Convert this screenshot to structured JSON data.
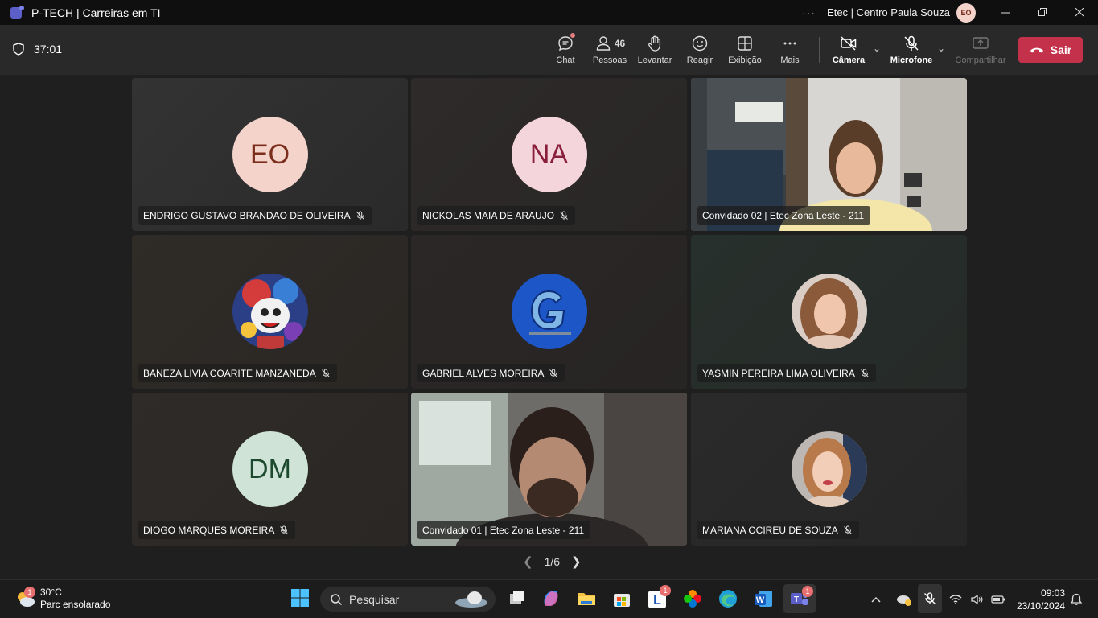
{
  "window": {
    "title": "P-TECH | Carreiras em TI",
    "more": "···",
    "org": "Etec | Centro Paula Souza",
    "user_initials": "EO"
  },
  "toolbar": {
    "timer": "37:01",
    "chat": "Chat",
    "people": "Pessoas",
    "people_count": "46",
    "raise": "Levantar",
    "react": "Reagir",
    "view": "Exibição",
    "more": "Mais",
    "camera": "Câmera",
    "mic": "Microfone",
    "share": "Compartilhar",
    "leave": "Sair"
  },
  "participants": [
    {
      "name": "ENDRIGO GUSTAVO BRANDAO DE OLIVEIRA",
      "initials": "EO",
      "avatar_bg": "#f4d3cb",
      "avatar_fg": "#7a2e1b",
      "muted": true
    },
    {
      "name": "NICKOLAS MAIA DE ARAUJO",
      "initials": "NA",
      "avatar_bg": "#f4d5dc",
      "avatar_fg": "#8a1f3b",
      "muted": true
    },
    {
      "name": "Convidado 02 | Etec Zona Leste - 211",
      "video": true,
      "muted": false
    },
    {
      "name": "BANEZA LIVIA COARITE MANZANEDA",
      "picture": "clown-avatar",
      "muted": true
    },
    {
      "name": "GABRIEL ALVES MOREIRA",
      "picture": "g-logo-avatar",
      "muted": true
    },
    {
      "name": "YASMIN PEREIRA LIMA OLIVEIRA",
      "picture": "photo-avatar",
      "muted": true
    },
    {
      "name": "DIOGO MARQUES MOREIRA",
      "initials": "DM",
      "avatar_bg": "#cfe3d6",
      "avatar_fg": "#1d4a2e",
      "muted": true
    },
    {
      "name": "Convidado 01 | Etec Zona Leste - 211",
      "video": true,
      "active": true,
      "muted": false
    },
    {
      "name": "MARIANA OCIREU DE SOUZA",
      "picture": "photo-avatar",
      "muted": true
    }
  ],
  "pager": {
    "label": "1/6"
  },
  "taskbar": {
    "temperature": "30°C",
    "weather": "Parc ensolarado",
    "weather_badge": "1",
    "search": "Pesquisar",
    "teams_badge": "1",
    "l_badge": "1",
    "time": "09:03",
    "date": "23/10/2024"
  }
}
